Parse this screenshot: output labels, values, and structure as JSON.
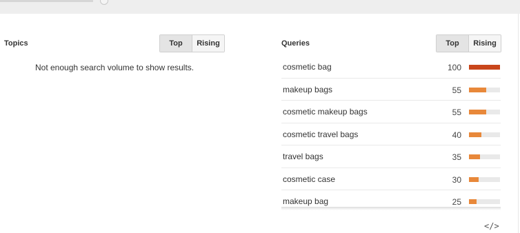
{
  "topics": {
    "title": "Topics",
    "toggle": {
      "top": "Top",
      "rising": "Rising",
      "selected": "Top"
    },
    "empty_message": "Not enough search volume to show results."
  },
  "queries": {
    "title": "Queries",
    "toggle": {
      "top": "Top",
      "rising": "Rising",
      "selected": "Top"
    },
    "rows": [
      {
        "query": "cosmetic bag",
        "value": 100
      },
      {
        "query": "makeup bags",
        "value": 55
      },
      {
        "query": "cosmetic makeup bags",
        "value": 55
      },
      {
        "query": "cosmetic travel bags",
        "value": 40
      },
      {
        "query": "travel bags",
        "value": 35
      },
      {
        "query": "cosmetic case",
        "value": 30
      },
      {
        "query": "makeup bag",
        "value": 25
      }
    ]
  },
  "colors": {
    "bar_top": "#c9461b",
    "bar_default": "#e8883a",
    "bar_track": "#e9e9e9",
    "toggle_active_bg": "#e4e4e4"
  },
  "icons": {
    "embed": "embed-code-icon"
  },
  "embed_glyph": "</>"
}
